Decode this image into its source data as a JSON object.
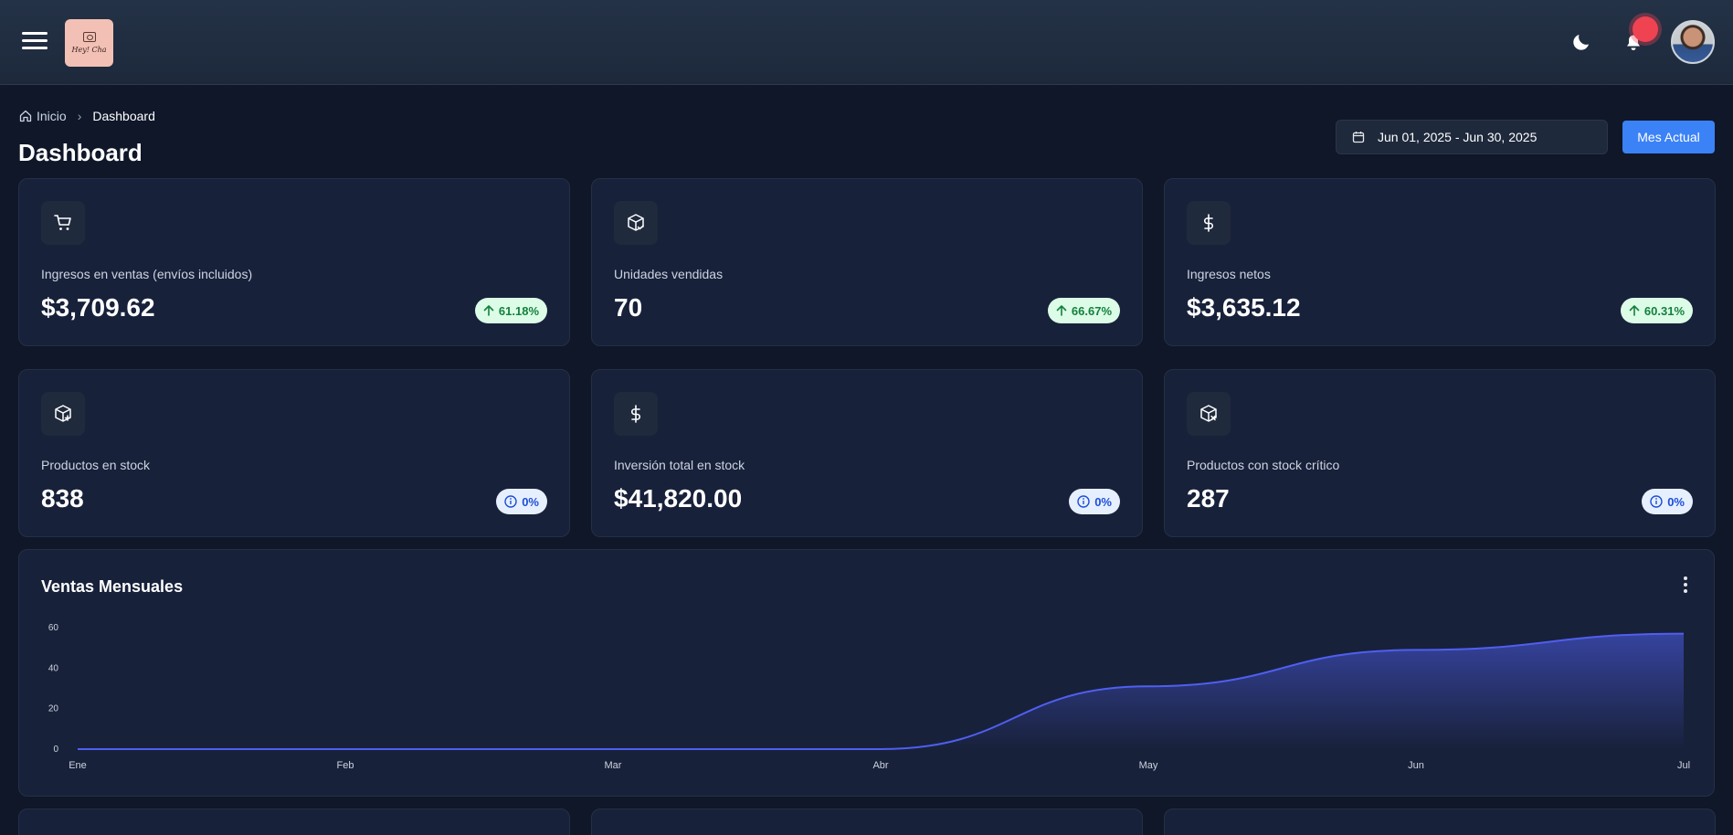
{
  "header": {
    "logo_text": "Hey! Cha",
    "icons": [
      "menu-icon",
      "moon-icon",
      "bell-icon"
    ],
    "notification_color": "#ef4352"
  },
  "breadcrumb": {
    "home": "Inicio",
    "current": "Dashboard"
  },
  "page": {
    "title": "Dashboard"
  },
  "filters": {
    "date_range": "Jun 01, 2025 - Jun 30, 2025",
    "current_month_button": "Mes Actual"
  },
  "colors": {
    "accent": "#3b82f6",
    "background": "#0f1729",
    "card": "#18213a",
    "positive": "#15803d",
    "line": "#4f5ff0"
  },
  "stats": [
    {
      "icon": "shopping-cart-icon",
      "label": "Ingresos en ventas (envíos incluidos)",
      "value": "$3,709.62",
      "badge": "61.18%",
      "trend": "up"
    },
    {
      "icon": "package-check-icon",
      "label": "Unidades vendidas",
      "value": "70",
      "badge": "66.67%",
      "trend": "up"
    },
    {
      "icon": "dollar-icon",
      "label": "Ingresos netos",
      "value": "$3,635.12",
      "badge": "60.31%",
      "trend": "up"
    },
    {
      "icon": "package-plus-icon",
      "label": "Productos en stock",
      "value": "838",
      "badge": "0%",
      "trend": "neutral"
    },
    {
      "icon": "dollar-icon",
      "label": "Inversión total en stock",
      "value": "$41,820.00",
      "badge": "0%",
      "trend": "neutral"
    },
    {
      "icon": "package-x-icon",
      "label": "Productos con stock crítico",
      "value": "287",
      "badge": "0%",
      "trend": "neutral"
    }
  ],
  "chart": {
    "title": "Ventas Mensuales"
  },
  "chart_data": {
    "type": "area",
    "title": "Ventas Mensuales",
    "categories": [
      "Ene",
      "Feb",
      "Mar",
      "Abr",
      "May",
      "Jun",
      "Jul"
    ],
    "values": [
      0,
      0,
      0,
      0,
      31,
      49,
      57
    ],
    "yticks": [
      0,
      20,
      40,
      60
    ],
    "ylim": [
      0,
      60
    ],
    "grid": false,
    "legend": "none"
  }
}
